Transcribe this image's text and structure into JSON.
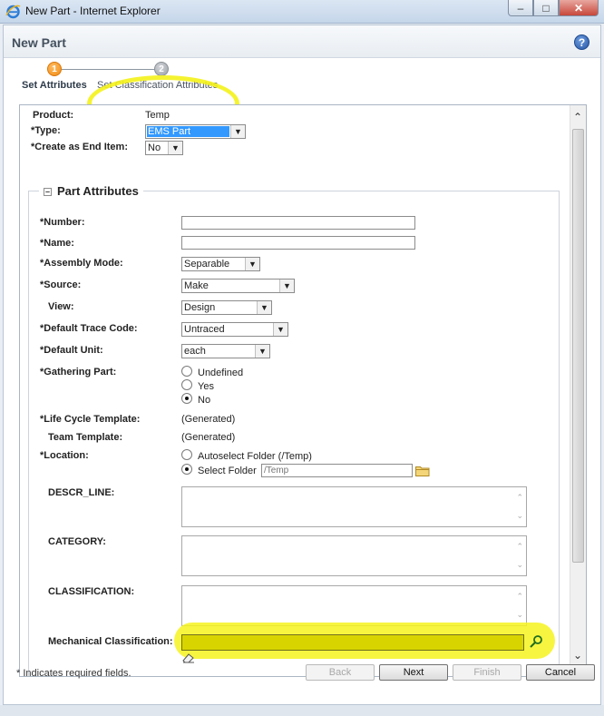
{
  "window": {
    "title": "New Part - Internet Explorer",
    "controls": [
      "minimize",
      "maximize",
      "close"
    ]
  },
  "page": {
    "title": "New Part",
    "help_icon": "help-icon"
  },
  "wizard": {
    "steps": [
      {
        "number": "1",
        "label": "Set Attributes",
        "active": true
      },
      {
        "number": "2",
        "label": "Set Classification Attributes",
        "active": false
      }
    ]
  },
  "header_fields": {
    "product": {
      "label": "Product:",
      "value": "Temp"
    },
    "type": {
      "label": "Type:",
      "required": "*",
      "value": "EMS Part"
    },
    "create_end_item": {
      "label": "Create as End Item:",
      "required": "*",
      "value": "No"
    }
  },
  "part_attributes": {
    "legend": "Part Attributes",
    "number": {
      "label": "Number:",
      "required": "*",
      "value": ""
    },
    "name": {
      "label": "Name:",
      "required": "*",
      "value": ""
    },
    "assembly_mode": {
      "label": "Assembly Mode:",
      "required": "*",
      "value": "Separable"
    },
    "source": {
      "label": "Source:",
      "required": "*",
      "value": "Make"
    },
    "view": {
      "label": "View:",
      "value": "Design"
    },
    "default_trace_code": {
      "label": "Default Trace Code:",
      "required": "*",
      "value": "Untraced"
    },
    "default_unit": {
      "label": "Default Unit:",
      "required": "*",
      "value": "each"
    },
    "gathering_part": {
      "label": "Gathering Part:",
      "required": "*",
      "options": [
        "Undefined",
        "Yes",
        "No"
      ],
      "selected": "No"
    },
    "life_cycle_template": {
      "label": "Life Cycle Template:",
      "required": "*",
      "value": "(Generated)"
    },
    "team_template": {
      "label": "Team Template:",
      "value": "(Generated)"
    },
    "location": {
      "label": "Location:",
      "required": "*",
      "autoselect": "Autoselect Folder (/Temp)",
      "select": "Select Folder",
      "folder_placeholder": "/Temp",
      "selected": "Select Folder"
    },
    "descr_line": {
      "label": "DESCR_LINE:",
      "value": ""
    },
    "category": {
      "label": "CATEGORY:",
      "value": ""
    },
    "classification": {
      "label": "CLASSIFICATION:",
      "value": ""
    },
    "mechanical_classification": {
      "label": "Mechanical Classification:",
      "value": ""
    }
  },
  "footer": {
    "required_note": "* Indicates required fields.",
    "buttons": {
      "back": "Back",
      "next": "Next",
      "finish": "Finish",
      "cancel": "Cancel"
    }
  },
  "colors": {
    "highlight": "#f4f219",
    "active_step": "#f08a12",
    "selection": "#3399ff"
  }
}
